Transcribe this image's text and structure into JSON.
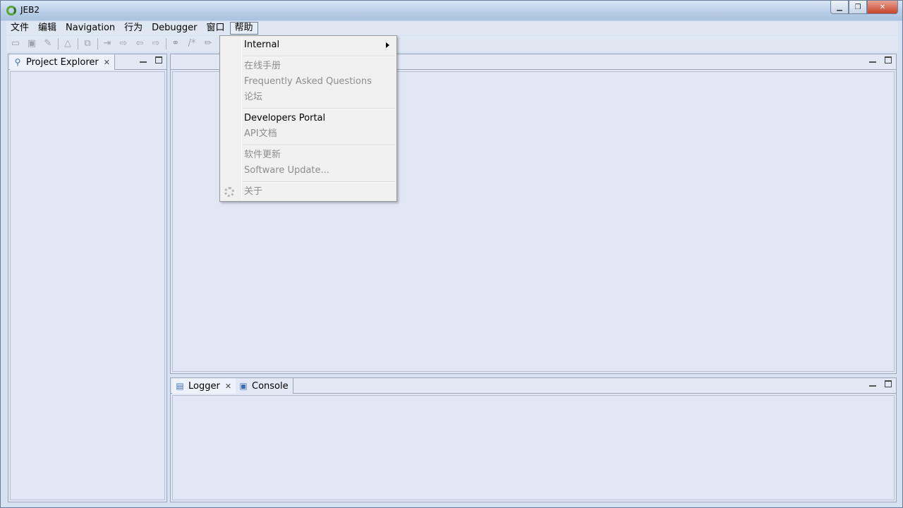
{
  "window": {
    "title": "JEB2"
  },
  "menubar": {
    "items": [
      "文件",
      "编辑",
      "Navigation",
      "行为",
      "Debugger",
      "窗口",
      "帮助"
    ],
    "active": "帮助"
  },
  "help_menu": {
    "internal": "Internal",
    "online_manual": "在线手册",
    "faq": "Frequently Asked Questions",
    "forum": "论坛",
    "developers_portal": "Developers Portal",
    "api_docs": "API文档",
    "software_update_cn": "软件更新",
    "software_update": "Software Update...",
    "about": "关于"
  },
  "project_explorer": {
    "tab_label": "Project Explorer"
  },
  "bottom_panel": {
    "logger_label": "Logger",
    "console_label": "Console"
  }
}
